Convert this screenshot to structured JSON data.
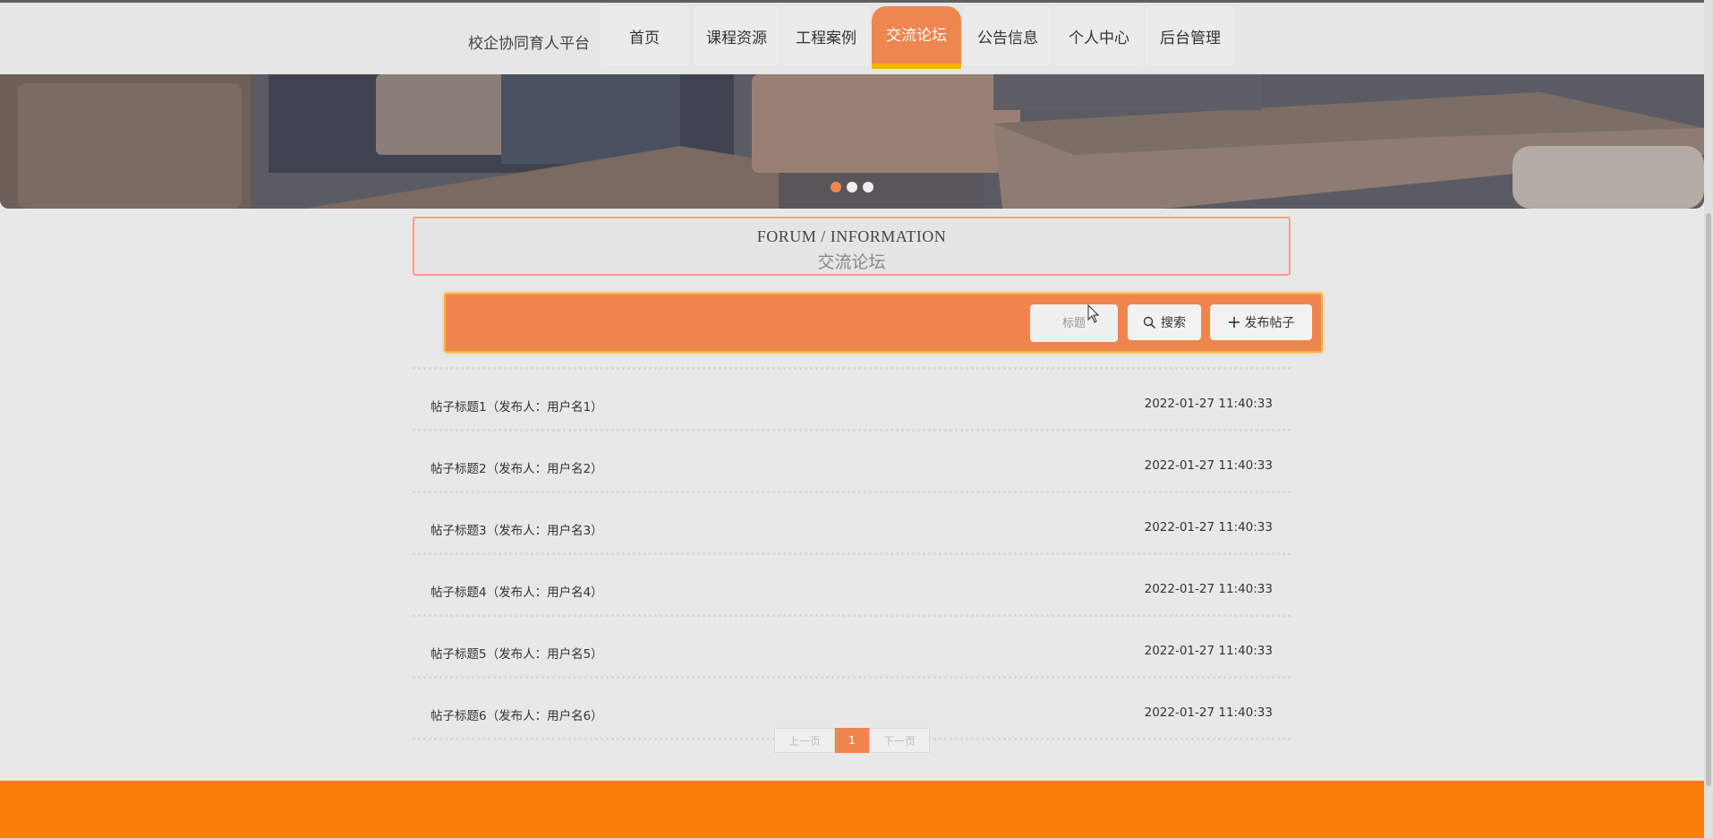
{
  "header": {
    "brand": "校企协同育人平台",
    "nav": [
      {
        "label": "首页",
        "active": false
      },
      {
        "label": "课程资源",
        "active": false
      },
      {
        "label": "工程案例",
        "active": false
      },
      {
        "label": "交流论坛",
        "active": true
      },
      {
        "label": "公告信息",
        "active": false
      },
      {
        "label": "个人中心",
        "active": false
      },
      {
        "label": "后台管理",
        "active": false
      }
    ]
  },
  "banner": {
    "slides": 3,
    "active_slide": 1,
    "image_description_icon": "classroom-desks-photo"
  },
  "section": {
    "title_en": "FORUM / INFORMATION",
    "title_cn": "交流论坛"
  },
  "search": {
    "placeholder": "标题",
    "search_label": "搜索",
    "publish_label": "发布帖子"
  },
  "posts": [
    {
      "title": "帖子标题1（发布人：用户名1）",
      "time": "2022-01-27 11:40:33"
    },
    {
      "title": "帖子标题2（发布人：用户名2）",
      "time": "2022-01-27 11:40:33"
    },
    {
      "title": "帖子标题3（发布人：用户名3）",
      "time": "2022-01-27 11:40:33"
    },
    {
      "title": "帖子标题4（发布人：用户名4）",
      "time": "2022-01-27 11:40:33"
    },
    {
      "title": "帖子标题5（发布人：用户名5）",
      "time": "2022-01-27 11:40:33"
    },
    {
      "title": "帖子标题6（发布人：用户名6）",
      "time": "2022-01-27 11:40:33"
    }
  ],
  "pagination": {
    "prev_label": "上一页",
    "current": "1",
    "next_label": "下一页"
  },
  "colors": {
    "accent": "#ef854d",
    "nav_underline": "#f4b400",
    "footer": "#f97e0a"
  }
}
